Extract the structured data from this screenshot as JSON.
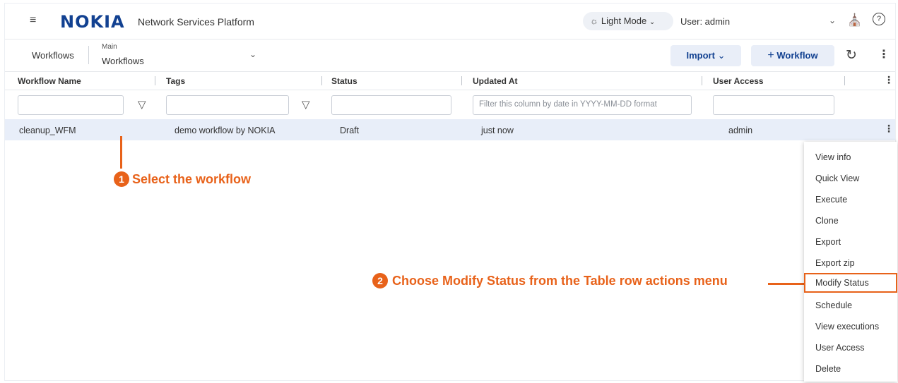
{
  "header": {
    "logo": "NOKIA",
    "app_name": "Network Services Platform",
    "mode_label": "Light Mode",
    "user_label": "User: admin",
    "icons": [
      "hamburger-icon",
      "sun-icon",
      "chevron-down-icon",
      "basket-icon",
      "help-icon"
    ]
  },
  "toolbar": {
    "breadcrumb_root": "Workflows",
    "breadcrumb_context": "Main",
    "breadcrumb_current": "Workflows",
    "import_label": "Import",
    "add_workflow_label": "Workflow",
    "icons": [
      "refresh-icon",
      "kebab-icon"
    ]
  },
  "table": {
    "columns": [
      "Workflow Name",
      "Tags",
      "Status",
      "Updated At",
      "User Access"
    ],
    "filter_placeholders": {
      "updated_at": "Filter this column by date in YYYY-MM-DD format"
    },
    "rows": [
      {
        "name": "cleanup_WFM",
        "tags": "demo workflow by NOKIA",
        "status": "Draft",
        "updated_at": "just now",
        "user_access": "admin"
      }
    ]
  },
  "row_menu": {
    "items": [
      "View info",
      "Quick View",
      "Execute",
      "Clone",
      "Export",
      "Export zip",
      "Modify Status",
      "Schedule",
      "View executions",
      "User Access",
      "Delete"
    ],
    "highlighted": "Modify Status"
  },
  "annotations": {
    "step1_number": "1",
    "step1_text": "Select the workflow",
    "step2_number": "2",
    "step2_text": "Choose Modify Status from the Table row actions menu",
    "accent_color": "#e8621a"
  }
}
